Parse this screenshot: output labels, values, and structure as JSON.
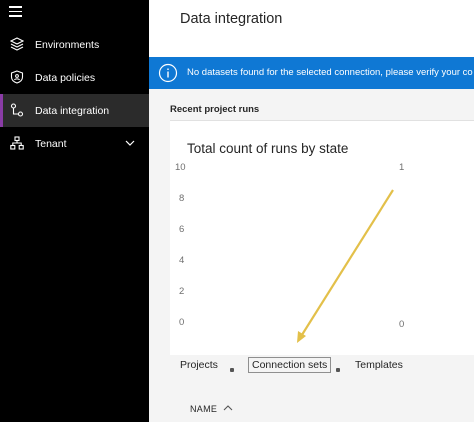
{
  "sidebar": {
    "items": [
      {
        "label": "Environments",
        "icon": "layers-icon"
      },
      {
        "label": "Data policies",
        "icon": "shield-icon"
      },
      {
        "label": "Data integration",
        "icon": "flow-icon",
        "active": true
      },
      {
        "label": "Tenant",
        "icon": "org-chart-icon",
        "expandable": true
      }
    ],
    "accent_color": "#8a3ca6"
  },
  "main": {
    "title": "Data integration",
    "banner": {
      "message": "No datasets found for the selected connection, please verify your co",
      "color": "#0f78d4"
    },
    "recent_runs": {
      "heading": "Recent project runs"
    },
    "chart": {
      "title": "Total count of runs by state",
      "left_ticks": [
        "10",
        "8",
        "6",
        "4",
        "2",
        "0"
      ],
      "right_ticks": [
        "1",
        "0"
      ]
    },
    "tabs": [
      {
        "label": "Projects",
        "active": false
      },
      {
        "label": "Connection sets",
        "active": true
      },
      {
        "label": "Templates",
        "active": false
      }
    ],
    "table": {
      "columns": [
        {
          "label": "NAME",
          "sort": "ascending"
        }
      ]
    }
  },
  "chart_data": {
    "type": "bar",
    "title": "Total count of runs by state",
    "ylim": [
      0,
      10
    ],
    "yticks": [
      0,
      2,
      4,
      6,
      8,
      10
    ],
    "secondary_yticks": [
      0,
      1
    ],
    "categories": [],
    "values": []
  },
  "annotation": {
    "arrow_color": "#e3c04a"
  }
}
